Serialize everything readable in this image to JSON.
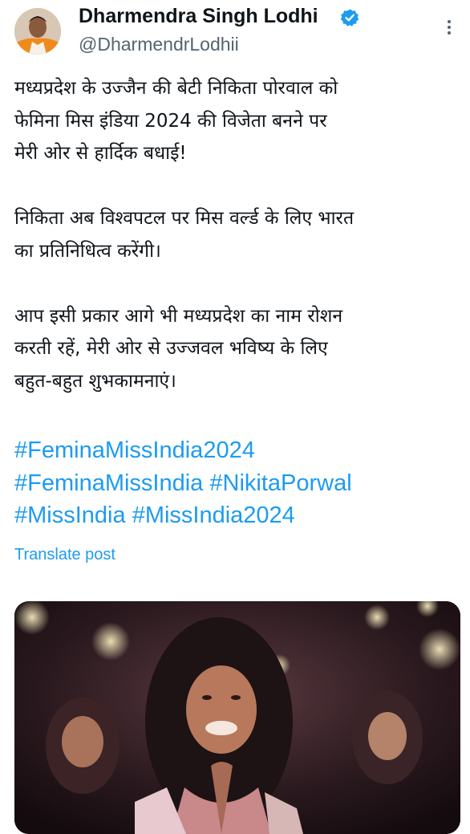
{
  "author": {
    "display_name": "Dharmendra Singh Lodhi",
    "handle": "@DharmendrLodhii",
    "verified_icon": "verified-badge-icon",
    "accent_color": "#1d9bf0"
  },
  "post": {
    "paragraphs": [
      [
        "मध्यप्रदेश के उज्जैन की बेटी निकिता पोरवाल को",
        "फेमिना मिस इंडिया 2024 की विजेता बनने पर",
        "मेरी ओर से हार्दिक बधाई!"
      ],
      [
        "निकिता अब विश्वपटल पर मिस वर्ल्ड के लिए भारत",
        "का प्रतिनिधित्व करेंगी।"
      ],
      [
        "आप इसी प्रकार आगे भी मध्यप्रदेश का नाम रोशन",
        "करती रहें, मेरी ओर से उज्जवल भविष्य के लिए",
        "बहुत-बहुत शुभकामनाएं।"
      ]
    ],
    "hashtags": [
      "#FeminaMissIndia2024",
      "#FeminaMissIndia",
      "#NikitaPorwal",
      "#MissIndia",
      "#MissIndia2024"
    ],
    "translate_label": "Translate post"
  },
  "icons": {
    "more": "more-options-icon"
  }
}
